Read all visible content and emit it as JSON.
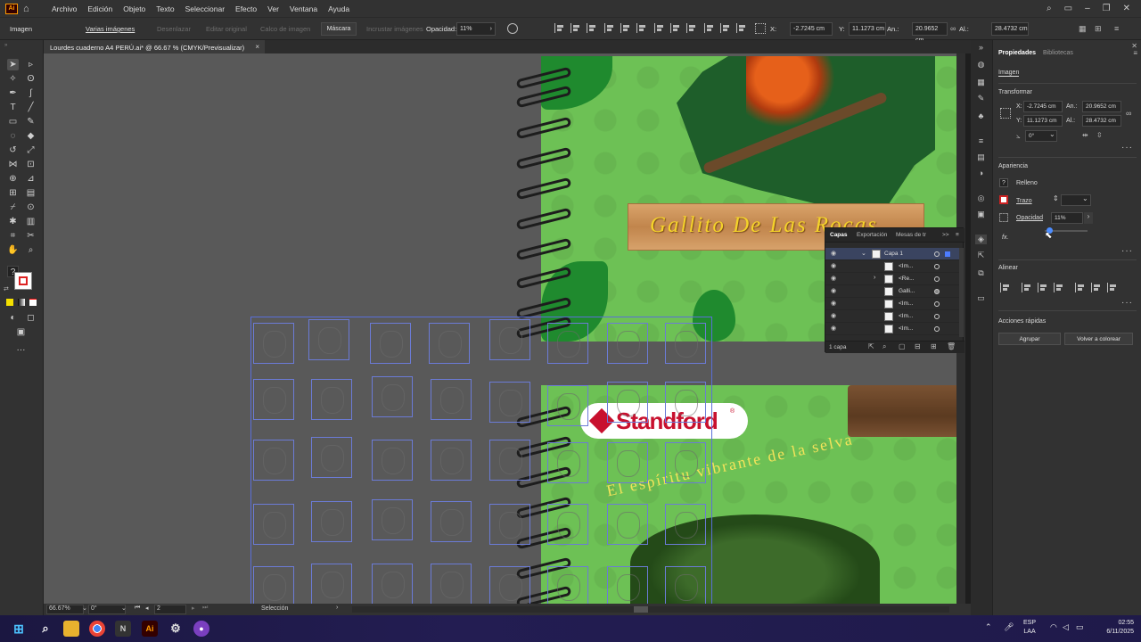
{
  "menubar": {
    "items": [
      "Archivo",
      "Edición",
      "Objeto",
      "Texto",
      "Seleccionar",
      "Efecto",
      "Ver",
      "Ventana",
      "Ayuda"
    ]
  },
  "control_bar": {
    "object_type": "Imagen",
    "multiple_images": "Varias imágenes",
    "disabled_buttons": [
      "Desenlazar",
      "Editar original",
      "Calco de imagen",
      "Incrustar imágenes"
    ],
    "mask_button": "Máscara",
    "opacity_label": "Opacidad:",
    "opacity_value": "11%",
    "x_label": "X:",
    "x_value": "-2.7245 cm",
    "y_label": "Y:",
    "y_value": "11.1273 cm",
    "w_label": "An.:",
    "w_value": "20.9652 cm",
    "h_label": "Al.:",
    "h_value": "28.4732 cm"
  },
  "document_tab": {
    "title": "Lourdes cuaderno A4 PERÚ.ai* @ 66.67 % (CMYK/Previsualizar)",
    "close": "×"
  },
  "artwork": {
    "title_banner": "Gallito De Las Rocas",
    "brand": "Standford",
    "brand_mark": "®",
    "slogan": "El espíritu vibrante de la selva",
    "colors": {
      "background_green": "#6dc155",
      "brand_red": "#c8102e",
      "slogan_yellow": "#f2e35a",
      "banner_text": "#f5d32a"
    }
  },
  "layers_panel": {
    "tabs": [
      "Capas",
      "Exportación",
      "Mesas de tr"
    ],
    "expand": ">>",
    "rows": [
      {
        "name": "Capa 1"
      },
      {
        "name": "<Im..."
      },
      {
        "name": "<Re..."
      },
      {
        "name": "Galli..."
      },
      {
        "name": "<Im..."
      },
      {
        "name": "<Im..."
      },
      {
        "name": "<Im..."
      }
    ],
    "footer": "1 capa"
  },
  "properties": {
    "tabs": [
      "Propiedades",
      "Bibliotecas"
    ],
    "object_type": "Imagen",
    "transform_title": "Transformar",
    "x_label": "X:",
    "x_value": "-2.7245 cm",
    "w_label": "An.:",
    "w_value": "20.9652 cm",
    "y_label": "Y:",
    "y_value": "11.1273 cm",
    "h_label": "Al.:",
    "h_value": "28.4732 cm",
    "angle_value": "0°",
    "appearance_title": "Apariencia",
    "fill_label": "Relleno",
    "stroke_label": "Trazo",
    "opacity_label": "Opacidad",
    "opacity_value": "11%",
    "fx_label": "fx.",
    "opacity_slider_fraction": 0.11,
    "align_title": "Alinear",
    "quick_actions_title": "Acciones rápidas",
    "group_button": "Agrupar",
    "recolor_button": "Volver a colorear"
  },
  "statusbar": {
    "zoom": "66.67%",
    "rotation": "0°",
    "artboard": "2",
    "tool": "Selección"
  },
  "taskbar": {
    "language": "ESP",
    "layout": "LAA",
    "time": "02:55",
    "date": "6/11/2025"
  }
}
